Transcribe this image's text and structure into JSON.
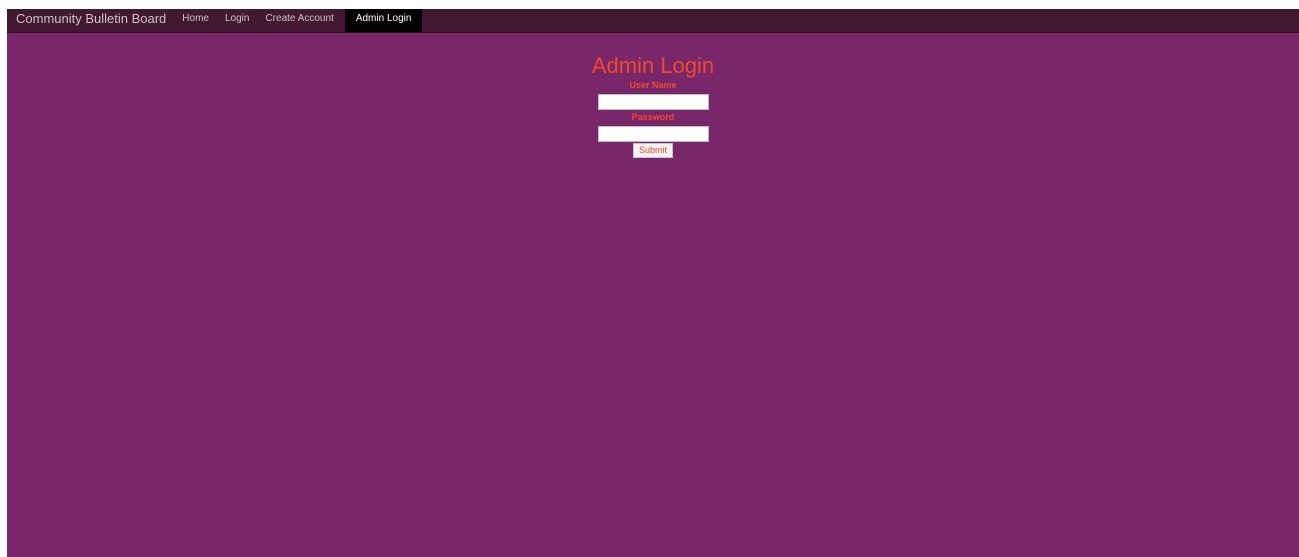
{
  "navbar": {
    "brand": "Community Bulletin Board",
    "items": [
      {
        "label": "Home",
        "active": false
      },
      {
        "label": "Login",
        "active": false
      },
      {
        "label": "Create Account",
        "active": false
      },
      {
        "label": "Admin Login",
        "active": true
      }
    ]
  },
  "form": {
    "title": "Admin Login",
    "username_label": "User Name",
    "username_value": "",
    "password_label": "Password",
    "password_value": "",
    "submit_label": "Submit"
  },
  "colors": {
    "page_background": "#7a266a",
    "navbar_background": "#431832",
    "active_tab_background": "#050103",
    "accent_text": "#ee4b2b"
  }
}
